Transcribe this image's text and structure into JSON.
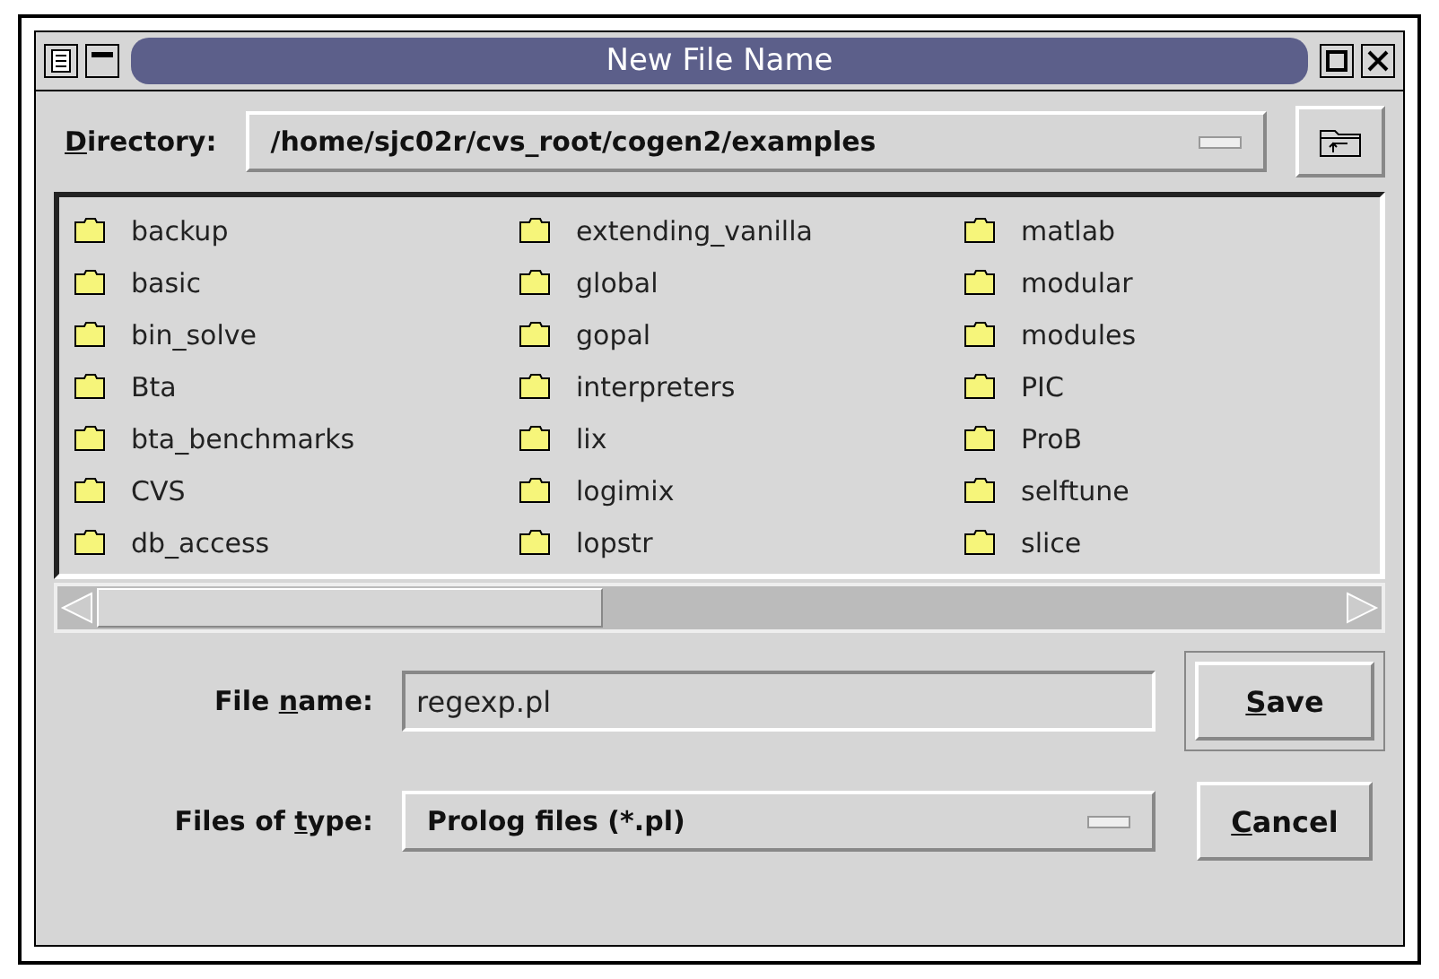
{
  "window": {
    "title": "New File Name"
  },
  "directory": {
    "label": {
      "key": "D",
      "after": "irectory:"
    },
    "value": "/home/sjc02r/cvs_root/cogen2/examples"
  },
  "files": [
    {
      "name": "backup"
    },
    {
      "name": "basic"
    },
    {
      "name": "bin_solve"
    },
    {
      "name": "Bta"
    },
    {
      "name": "bta_benchmarks"
    },
    {
      "name": "CVS"
    },
    {
      "name": "db_access"
    },
    {
      "name": "extending_vanilla"
    },
    {
      "name": "global"
    },
    {
      "name": "gopal"
    },
    {
      "name": "interpreters"
    },
    {
      "name": "lix"
    },
    {
      "name": "logimix"
    },
    {
      "name": "lopstr"
    },
    {
      "name": "matlab"
    },
    {
      "name": "modular"
    },
    {
      "name": "modules"
    },
    {
      "name": "PIC"
    },
    {
      "name": "ProB"
    },
    {
      "name": "selftune"
    },
    {
      "name": "slice"
    }
  ],
  "file_name": {
    "label": {
      "before": "File ",
      "key": "n",
      "after": "ame:"
    },
    "value": "regexp.pl"
  },
  "file_type": {
    "label": {
      "before": "Files of ",
      "key": "t",
      "after": "ype:"
    },
    "value": "Prolog files (*.pl)"
  },
  "buttons": [
    {
      "label": {
        "key": "S",
        "after": "ave"
      },
      "default": true
    },
    {
      "label": {
        "key": "C",
        "after": "ancel"
      },
      "default": false
    }
  ]
}
